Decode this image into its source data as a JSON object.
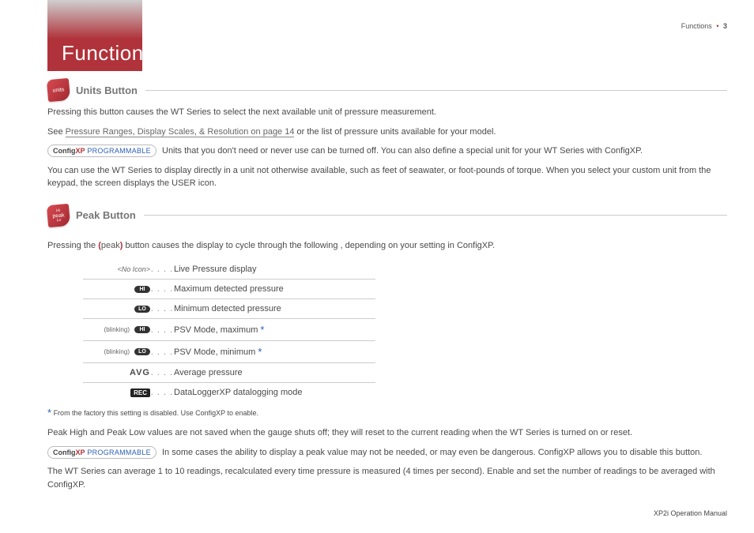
{
  "header": {
    "topRightLabel": "Functions",
    "topRightPage": "3",
    "title": "Functions"
  },
  "units": {
    "iconLabel": "units",
    "heading": "Units Button",
    "p1": "Pressing this button causes the WT Series to select the next available unit of pressure measurement.",
    "p2a": "See ",
    "p2link": "Pressure Ranges, Display Scales, & Resolution on page 14",
    "p2b": " or the list of pressure units available for your model.",
    "badgeCfg": "Config",
    "badgeXP": "XP",
    "badgeProg": " PROGRAMMABLE",
    "p3": " Units that you don't need or never use can be turned off. You can also define a special unit for your WT Series with ConfigXP.",
    "p4": "You can use the WT Series to display directly in a unit not otherwise available, such as feet of seawater, or foot‑pounds of torque. When you select your custom unit from the keypad, the screen displays the USER icon."
  },
  "peak": {
    "iconTop": "Hi",
    "iconMain": "peak",
    "iconBot": "Lo",
    "heading": "Peak Button",
    "introA": "Pressing the ",
    "introWord": "peak",
    "introB": " button causes the display to cycle through the following , depending on your setting in ConfigXP.",
    "rows": [
      {
        "iconType": "none",
        "iconText": "<No Icon>",
        "desc": "Live Pressure display",
        "star": false
      },
      {
        "iconType": "pill",
        "iconText": "HI",
        "desc": "Maximum detected pressure",
        "star": false
      },
      {
        "iconType": "pill",
        "iconText": "LO",
        "desc": "Minimum detected pressure",
        "star": false
      },
      {
        "iconType": "blink",
        "iconText": "HI",
        "desc": "PSV Mode, maximum ",
        "star": true
      },
      {
        "iconType": "blink",
        "iconText": "LO",
        "desc": "PSV Mode, minimum ",
        "star": true
      },
      {
        "iconType": "avg",
        "iconText": "AVG",
        "desc": "Average pressure",
        "star": false
      },
      {
        "iconType": "rec",
        "iconText": "REC",
        "desc": "DataLoggerXP datalogging mode",
        "star": false
      }
    ],
    "blinkingLabel": "(blinking)",
    "footnote": " From the factory this setting is disabled. Use ConfigXP to enable.",
    "p1": "Peak High and Peak Low values are not saved when the gauge shuts off; they will reset to the current reading when the WT Series is turned on or reset.",
    "p2": " In some cases the ability to display a peak value may not be needed, or may even be dangerous. ConfigXP allows you to disable this button.",
    "p3": "The WT Series can average 1 to 10 readings, recalculated every time pressure is measured (4 times per second). Enable and set the number of readings to be averaged with ConfigXP."
  },
  "footer": {
    "text": "XP2i Operation Manual"
  }
}
